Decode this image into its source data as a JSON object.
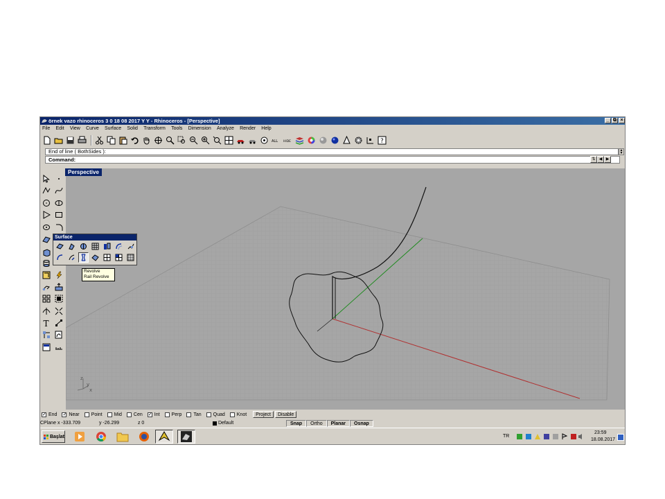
{
  "window": {
    "title": "örnek vazo rhinoceros 3 0 18 08 2017 Y Y - Rhinoceros - [Perspective]",
    "controls": [
      "_",
      "⧉",
      "×"
    ]
  },
  "menu": [
    "File",
    "Edit",
    "View",
    "Curve",
    "Surface",
    "Solid",
    "Transform",
    "Tools",
    "Dimension",
    "Analyze",
    "Render",
    "Help"
  ],
  "command": {
    "history": "End of line ( BothSides ):",
    "prompt": "Command:"
  },
  "viewport": {
    "label": "Perspective",
    "axis_labels": {
      "z": "z",
      "y": "y",
      "x": "x"
    }
  },
  "surface_palette": {
    "title": "Surface",
    "tooltip": [
      "Revolve",
      "Rail Revolve"
    ]
  },
  "osnap": [
    {
      "label": "End",
      "checked": true
    },
    {
      "label": "Near",
      "checked": true
    },
    {
      "label": "Point",
      "checked": false
    },
    {
      "label": "Mid",
      "checked": false
    },
    {
      "label": "Cen",
      "checked": false
    },
    {
      "label": "Int",
      "checked": true
    },
    {
      "label": "Perp",
      "checked": false
    },
    {
      "label": "Tan",
      "checked": false
    },
    {
      "label": "Quad",
      "checked": false
    },
    {
      "label": "Knot",
      "checked": false
    }
  ],
  "osnap_buttons": [
    "Project",
    "Disable"
  ],
  "status": {
    "cplane": "CPlane",
    "x": "x -333.709",
    "y": "y -26.299",
    "z": "z 0",
    "layer": "Default",
    "toggles": [
      "Snap",
      "Ortho",
      "Planar",
      "Osnap"
    ]
  },
  "taskbar": {
    "start": "Başlat",
    "lang": "TR",
    "time": "23:59",
    "date": "18.08.2017"
  },
  "colors": {
    "titlebar": "#0a246a",
    "viewport": "#a6a6a6",
    "x_axis": "#b03030",
    "y_axis": "#1e8a1e"
  }
}
